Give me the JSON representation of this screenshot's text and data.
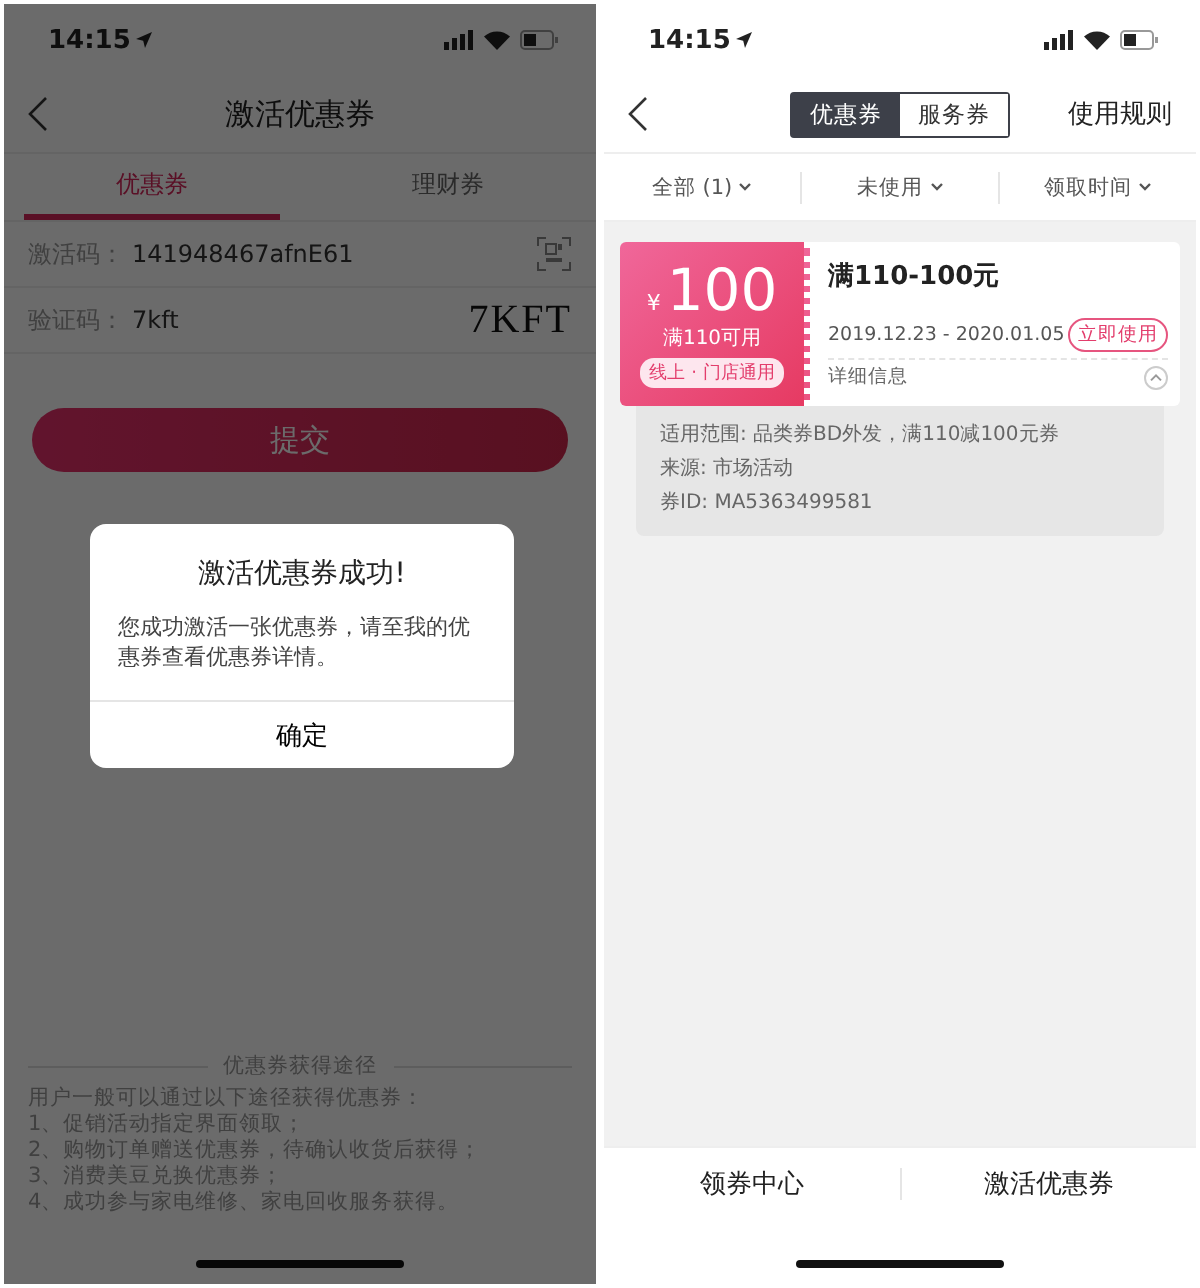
{
  "screens": [
    {
      "kind": "activate",
      "status_bar": {
        "time": "14:15"
      },
      "title": "激活优惠券",
      "tabs": [
        {
          "label": "优惠券",
          "selected": true
        },
        {
          "label": "理财券",
          "selected": false
        }
      ],
      "fields": [
        {
          "kind": "qr",
          "label": "激活码：",
          "value": "141948467afnE61"
        },
        {
          "kind": "captcha",
          "label": "验证码：",
          "value": "7kft",
          "captcha": "7KFT"
        }
      ],
      "submit": "提交",
      "info": {
        "title": "优惠券获得途径",
        "lines": [
          "用户一般可以通过以下途径获得优惠券：",
          "1、促销活动指定界面领取；",
          "2、购物订单赠送优惠券，待确认收货后获得；",
          "3、消费美豆兑换优惠券；",
          "4、成功参与家电维修、家电回收服务获得。"
        ]
      },
      "dialog": {
        "title": "激活优惠券成功!",
        "message": "您成功激活一张优惠券，请至我的优惠券查看优惠券详情。",
        "button": "确定"
      }
    },
    {
      "kind": "list",
      "status_bar": {
        "time": "14:15"
      },
      "segments": [
        {
          "label": "优惠券",
          "selected": true
        },
        {
          "label": "服务券",
          "selected": false
        }
      ],
      "rules_link": "使用规则",
      "filters": [
        "全部 (1)",
        "未使用",
        "领取时间"
      ],
      "coupon": {
        "currency": "¥",
        "amount": "100",
        "condition": "满110可用",
        "tag": "线上 · 门店通用",
        "title": "满110-100元",
        "dates": "2019.12.23 - 2020.01.05",
        "use_button": "立即使用",
        "details_label": "详细信息",
        "expanded": true,
        "details": [
          "适用范围: 品类券BD外发，满110减100元券",
          "来源: 市场活动",
          "券ID: MA5363499581"
        ]
      },
      "bottom_tabs": [
        "领券中心",
        "激活优惠券"
      ]
    }
  ]
}
